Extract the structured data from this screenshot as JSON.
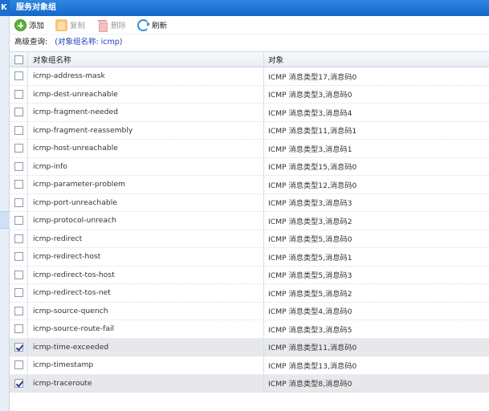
{
  "left_panel": {
    "collapse_label": "K"
  },
  "window": {
    "title": "服务对象组"
  },
  "toolbar": {
    "add_label": "添加",
    "copy_label": "复制",
    "delete_label": "删除",
    "refresh_label": "刷新"
  },
  "query": {
    "label": "高级查询:",
    "value": "(对象组名称: icmp)"
  },
  "table": {
    "headers": {
      "name": "对象组名称",
      "object": "对象"
    },
    "rows": [
      {
        "name": "icmp-address-mask",
        "object": "ICMP 消息类型17,消息码0",
        "checked": false
      },
      {
        "name": "icmp-dest-unreachable",
        "object": "ICMP 消息类型3,消息码0",
        "checked": false
      },
      {
        "name": "icmp-fragment-needed",
        "object": "ICMP 消息类型3,消息码4",
        "checked": false
      },
      {
        "name": "icmp-fragment-reassembly",
        "object": "ICMP 消息类型11,消息码1",
        "checked": false
      },
      {
        "name": "icmp-host-unreachable",
        "object": "ICMP 消息类型3,消息码1",
        "checked": false
      },
      {
        "name": "icmp-info",
        "object": "ICMP 消息类型15,消息码0",
        "checked": false
      },
      {
        "name": "icmp-parameter-problem",
        "object": "ICMP 消息类型12,消息码0",
        "checked": false
      },
      {
        "name": "icmp-port-unreachable",
        "object": "ICMP 消息类型3,消息码3",
        "checked": false
      },
      {
        "name": "icmp-protocol-unreach",
        "object": "ICMP 消息类型3,消息码2",
        "checked": false
      },
      {
        "name": "icmp-redirect",
        "object": "ICMP 消息类型5,消息码0",
        "checked": false
      },
      {
        "name": "icmp-redirect-host",
        "object": "ICMP 消息类型5,消息码1",
        "checked": false
      },
      {
        "name": "icmp-redirect-tos-host",
        "object": "ICMP 消息类型5,消息码3",
        "checked": false
      },
      {
        "name": "icmp-redirect-tos-net",
        "object": "ICMP 消息类型5,消息码2",
        "checked": false
      },
      {
        "name": "icmp-source-quench",
        "object": "ICMP 消息类型4,消息码0",
        "checked": false
      },
      {
        "name": "icmp-source-route-fail",
        "object": "ICMP 消息类型3,消息码5",
        "checked": false
      },
      {
        "name": "icmp-time-exceeded",
        "object": "ICMP 消息类型11,消息码0",
        "checked": true
      },
      {
        "name": "icmp-timestamp",
        "object": "ICMP 消息类型13,消息码0",
        "checked": false
      },
      {
        "name": "icmp-traceroute",
        "object": "ICMP 消息类型8,消息码0",
        "checked": true
      }
    ]
  },
  "colors": {
    "titlebar": "#1b6fcf",
    "query_value": "#1a3fb8",
    "checked_row": "#e6e8eb"
  }
}
